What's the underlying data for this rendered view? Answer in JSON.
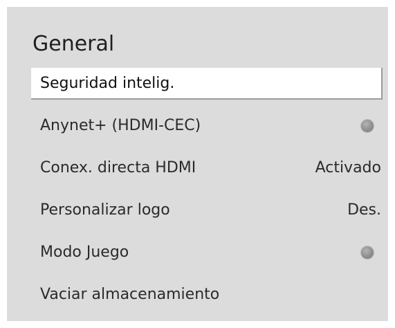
{
  "menu": {
    "title": "General",
    "items": [
      {
        "label": "Seguridad intelig.",
        "selected": true
      },
      {
        "label": "Anynet+ (HDMI-CEC)",
        "control": "toggle",
        "state": "off"
      },
      {
        "label": "Conex. directa HDMI",
        "value": "Activado"
      },
      {
        "label": "Personalizar logo",
        "value": "Des."
      },
      {
        "label": "Modo Juego",
        "control": "toggle",
        "state": "off"
      },
      {
        "label": "Vaciar almacenamiento"
      }
    ]
  },
  "colors": {
    "panel_background": "#dcdcdc",
    "selected_background": "#ffffff",
    "toggle_off": "#8f8f8f"
  },
  "icons": {
    "toggle": "toggle-off-dot-icon"
  }
}
